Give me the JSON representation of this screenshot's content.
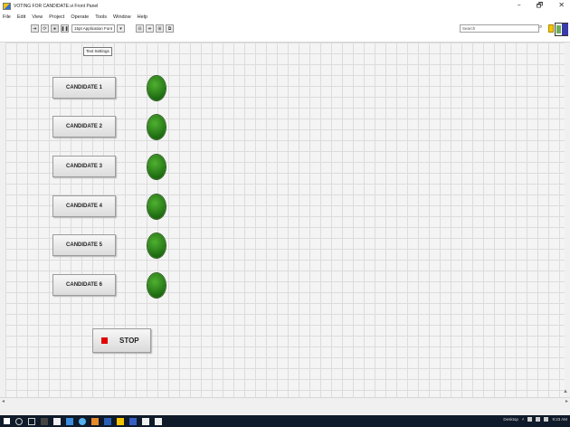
{
  "window": {
    "title": "VOTING FOR CANDIDATE.vi Front Panel",
    "controls": {
      "minimize": "–",
      "maximize": "🗗",
      "close": "✕"
    }
  },
  "menu": [
    "File",
    "Edit",
    "View",
    "Project",
    "Operate",
    "Tools",
    "Window",
    "Help"
  ],
  "toolbar": {
    "font_label": "15pt Application Font",
    "search_placeholder": "Search",
    "tooltip": "Text Settings",
    "icons": [
      "run-arrow-icon",
      "run-continuously-icon",
      "abort-icon",
      "pause-icon",
      "align-icon",
      "distribute-icon",
      "resize-icon",
      "reorder-icon",
      "search-icon",
      "help-icon",
      "vi-icon"
    ]
  },
  "panel": {
    "candidates": [
      {
        "label": "CANDIDATE 1"
      },
      {
        "label": "CANDIDATE 2"
      },
      {
        "label": "CANDIDATE 3"
      },
      {
        "label": "CANDIDATE 4"
      },
      {
        "label": "CANDIDATE 5"
      },
      {
        "label": "CANDIDATE 6"
      }
    ],
    "stop_label": "STOP",
    "colors": {
      "led_on": "#2f8a1e",
      "stop": "#e10000",
      "grid": "#dcdcdc"
    }
  },
  "taskbar": {
    "tray_text": "Desktop",
    "clock": "9:23 AM"
  }
}
